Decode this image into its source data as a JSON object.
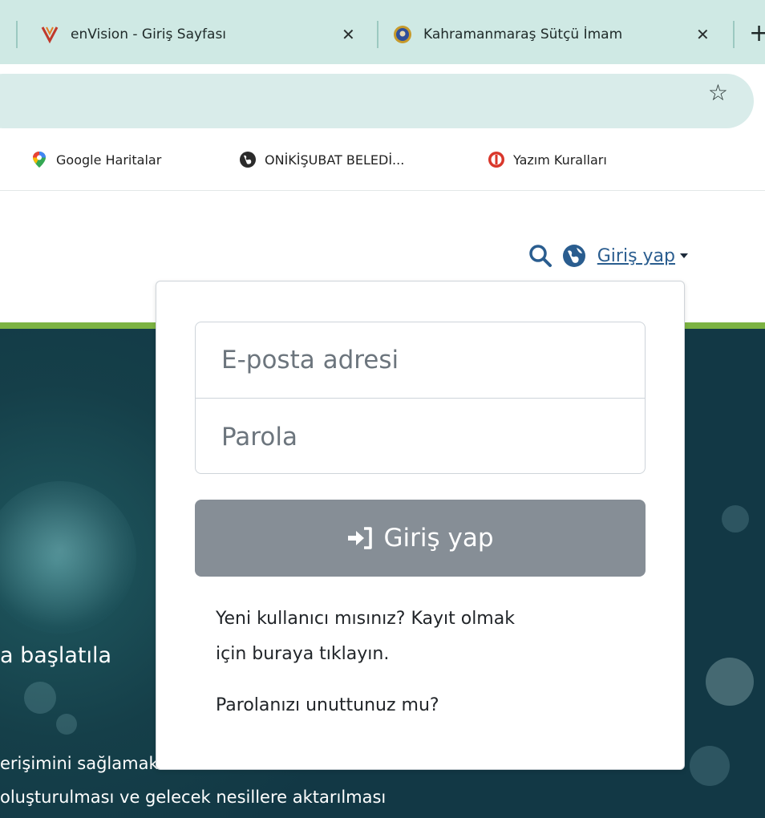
{
  "browser": {
    "tabs": [
      {
        "title": "enVision - Giriş Sayfası",
        "icon": "envision-logo-icon",
        "close": "✕"
      },
      {
        "title": "Kahramanmaraş Sütçü İmam",
        "icon": "university-seal-icon",
        "close": "✕"
      }
    ],
    "new_tab_glyph": "+",
    "bookmark_star": "☆",
    "bookmarks": [
      {
        "label": "Google Haritalar",
        "icon": "map-pin-icon"
      },
      {
        "label": "ONİKİŞUBAT BELEDİ...",
        "icon": "globe-icon"
      },
      {
        "label": "Yazım Kuralları",
        "icon": "tdk-logo-icon"
      }
    ]
  },
  "header": {
    "login_link": "Giriş yap"
  },
  "hero": {
    "line1": "a başlatıla",
    "line2": "erişimini sağlamak",
    "line3": "oluşturulması ve gelecek nesillere aktarılması"
  },
  "login": {
    "email_placeholder": "E-posta adresi",
    "password_placeholder": "Parola",
    "button_label": "Giriş yap",
    "register_line1": "Yeni kullanıcı mısınız? Kayıt olmak",
    "register_line2": "için buraya tıklayın.",
    "forgot": "Parolanızı unuttunuz mu?"
  },
  "colors": {
    "tabstrip": "#cfe9e4",
    "accent_green": "#7cb342",
    "hero_teal": "#153f49",
    "button_gray": "#868e96",
    "link_blue": "#2a5d8f"
  }
}
